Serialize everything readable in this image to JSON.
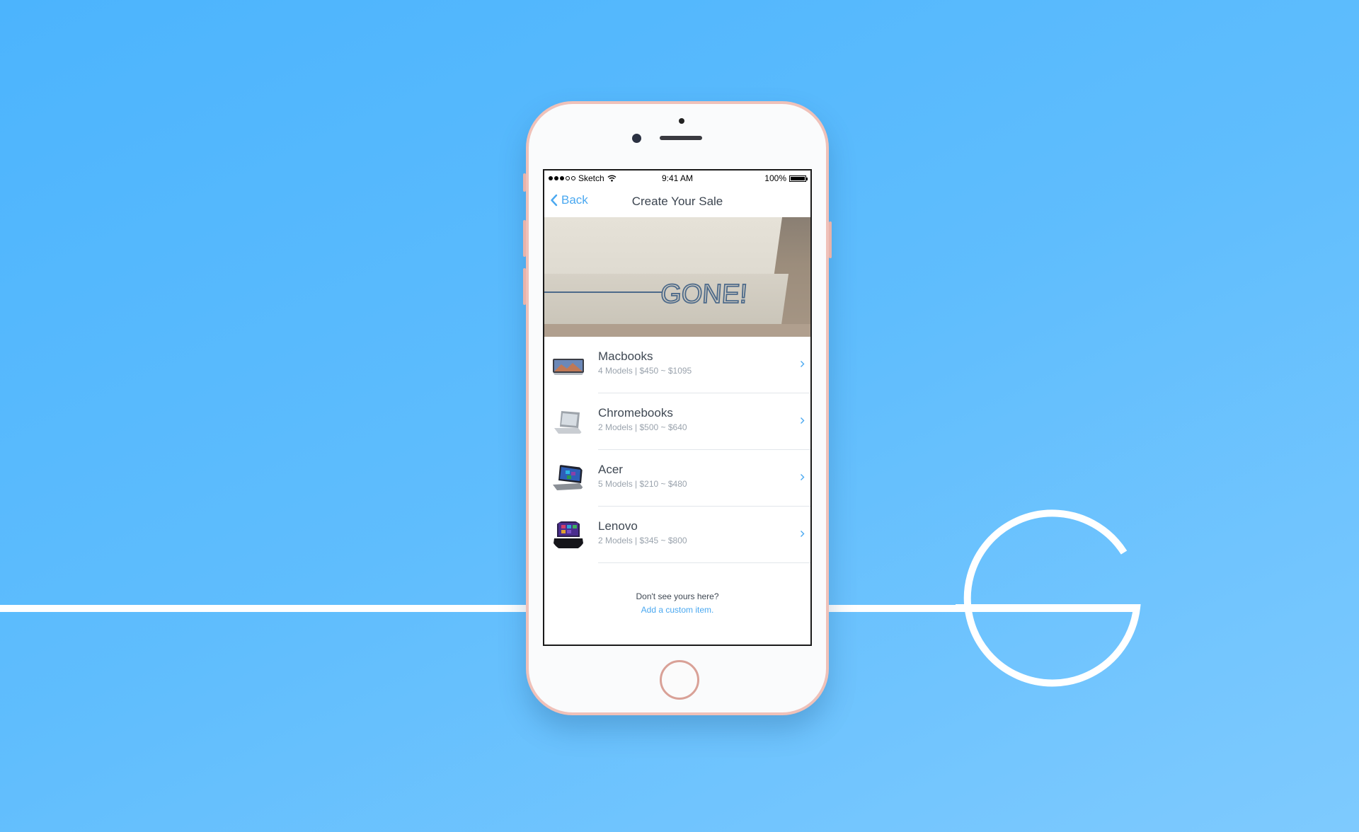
{
  "status_bar": {
    "carrier": "Sketch",
    "time": "9:41 AM",
    "battery": "100%",
    "battery_level": 1.0
  },
  "nav": {
    "back_label": "Back",
    "title": "Create Your Sale"
  },
  "hero": {
    "brand_text": "GONE!"
  },
  "items": [
    {
      "title": "Macbooks",
      "subtitle": "4 Models | $450 ~ $1095"
    },
    {
      "title": "Chromebooks",
      "subtitle": "2 Models | $500 ~ $640"
    },
    {
      "title": "Acer",
      "subtitle": "5 Models | $210 ~ $480"
    },
    {
      "title": "Lenovo",
      "subtitle": "2 Models | $345 ~ $800"
    }
  ],
  "footer": {
    "question": "Don't see yours here?",
    "link": "Add a custom item."
  },
  "colors": {
    "accent": "#4aa8f0",
    "background": "#5fbdfd",
    "phone_frame": "#efc1b9"
  }
}
